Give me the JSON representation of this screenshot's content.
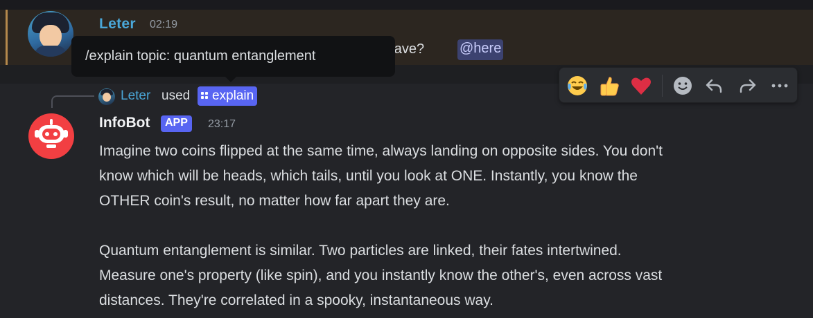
{
  "previous_message": {
    "username": "Leter",
    "timestamp": "02:19",
    "text_fragment": "d have?",
    "mention": "@here"
  },
  "tooltip": {
    "text": "/explain topic: quantum entanglement"
  },
  "command_usage": {
    "user": "Leter",
    "used_word": "used",
    "command": "explain"
  },
  "bot_message": {
    "name": "InfoBot",
    "badge": "APP",
    "timestamp": "23:17",
    "lines": [
      "Imagine two coins flipped at the same time, always landing on opposite sides. You don't",
      "know which will be heads, which tails, until you look at ONE. Instantly, you know the",
      "OTHER coin's result, no matter how far apart they are.",
      "Quantum entanglement is similar. Two particles are linked, their fates intertwined.",
      "Measure one's property (like spin), and you instantly know the other's, even across vast",
      "distances. They're correlated in a spooky, instantaneous way."
    ]
  },
  "toolbar": {
    "reactions": [
      "😂",
      "👍",
      "❤️"
    ],
    "icons": [
      "add-reaction-icon",
      "reply-icon",
      "forward-icon",
      "more-icon"
    ]
  },
  "colors": {
    "mention_highlight": "#2c2620",
    "mention_bar": "#b5894c",
    "username": "#4aa7d8",
    "blurple": "#5865f2",
    "bot_avatar": "#f23f42"
  }
}
